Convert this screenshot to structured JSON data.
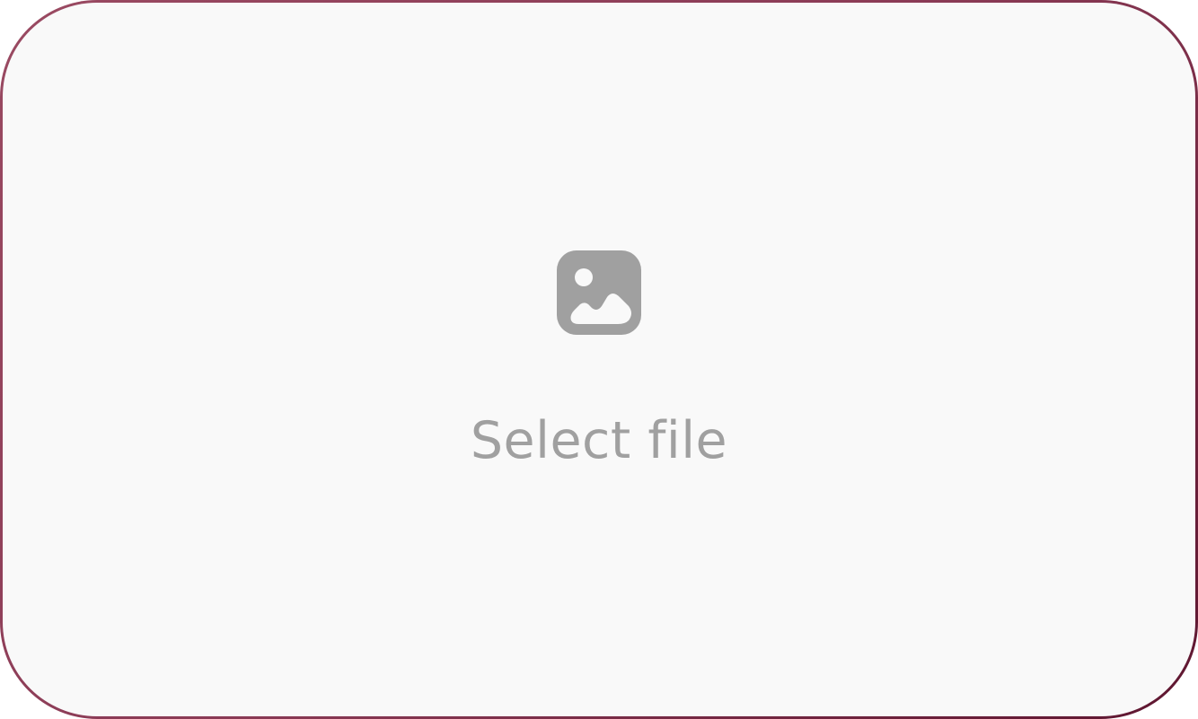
{
  "upload": {
    "label": "Select file",
    "icon": "image-icon",
    "colors": {
      "border_start": "#9a4a62",
      "border_end": "#5e1630",
      "background": "#f9f9f9",
      "icon_and_text": "#a0a0a0"
    }
  }
}
